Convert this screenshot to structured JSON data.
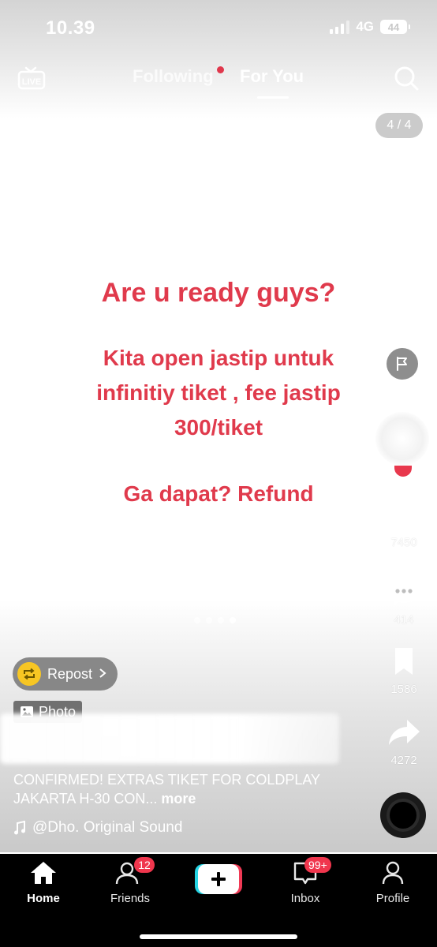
{
  "status": {
    "time": "10.39",
    "network": "4G",
    "battery": "44"
  },
  "top_nav": {
    "live_label": "LIVE",
    "following": "Following",
    "for_you": "For You"
  },
  "page_counter": "4 / 4",
  "post": {
    "headline": "Are u ready guys?",
    "lines": [
      "Kita open jastip untuk",
      "infinitiy tiket , fee jastip",
      "300/tiket"
    ],
    "footer": "Ga dapat? Refund"
  },
  "actions": {
    "likes": "7450",
    "comments": "414",
    "bookmarks": "1586",
    "shares": "4272"
  },
  "repost_label": "Repost",
  "photo_label": "Photo",
  "caption": "CONFIRMED! EXTRAS TIKET FOR COLDPLAY JAKARTA H-30 CON...",
  "caption_more": "more",
  "sound": "@Dho. Original Sound",
  "bottom_nav": {
    "home": "Home",
    "friends": "Friends",
    "friends_badge": "12",
    "inbox": "Inbox",
    "inbox_badge": "99+",
    "profile": "Profile"
  },
  "colors": {
    "accent_text": "#e03a4c",
    "badge": "#f0364d",
    "repost_icon": "#f7c623"
  }
}
